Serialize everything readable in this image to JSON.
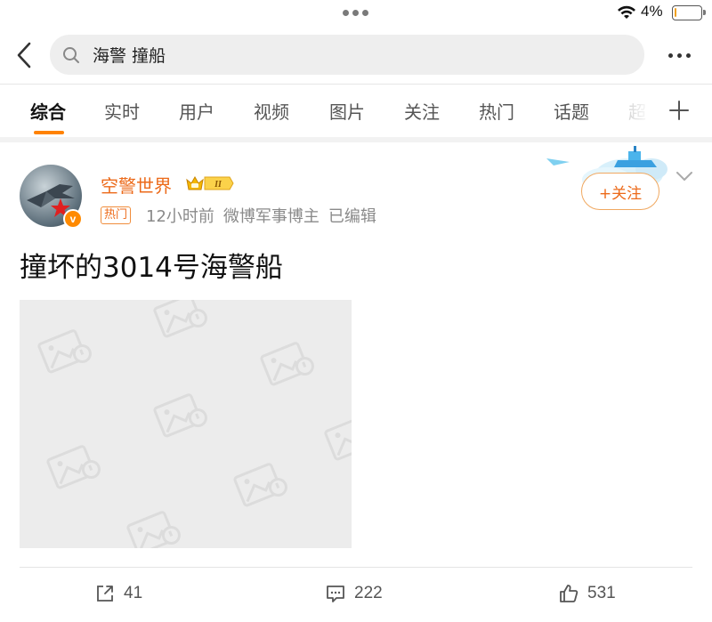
{
  "status_bar": {
    "battery_percent": "4%",
    "battery_level": 0.04
  },
  "search": {
    "query": "海警 撞船"
  },
  "tabs": [
    {
      "label": "综合",
      "active": true
    },
    {
      "label": "实时"
    },
    {
      "label": "用户"
    },
    {
      "label": "视频"
    },
    {
      "label": "图片"
    },
    {
      "label": "关注"
    },
    {
      "label": "热门"
    },
    {
      "label": "话题"
    },
    {
      "label": "超"
    }
  ],
  "post": {
    "username": "空警世界",
    "vip_level": "II",
    "hot_tag": "热门",
    "time": "12小时前",
    "source": "微博军事博主",
    "edited": "已编辑",
    "follow_label": "+关注",
    "text": "撞坏的3014号海警船",
    "actions": {
      "reposts": "41",
      "comments": "222",
      "likes": "531"
    }
  },
  "colors": {
    "accent": "#ff8200",
    "username": "#ec6a1a"
  }
}
